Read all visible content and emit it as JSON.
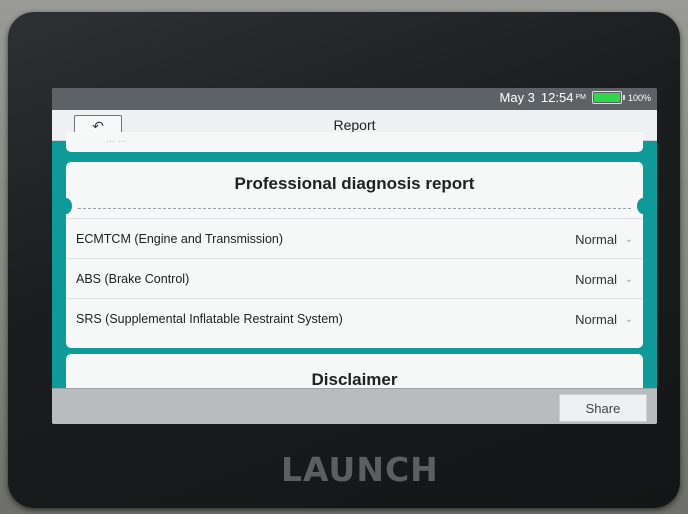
{
  "device": {
    "brand": "LAUNCH"
  },
  "status_bar": {
    "date": "May 3",
    "time": "12:54",
    "ampm": "PM",
    "battery_pct": "100%",
    "battery_level": 1.0
  },
  "title_bar": {
    "title": "Report",
    "back_icon": "back-arrow-icon"
  },
  "top_card": {
    "faded_text": "… …"
  },
  "report": {
    "heading": "Professional diagnosis report",
    "rows": [
      {
        "system": "ECMTCM (Engine and Transmission)",
        "status": "Normal"
      },
      {
        "system": "ABS (Brake Control)",
        "status": "Normal"
      },
      {
        "system": "SRS (Supplemental Inflatable Restraint System)",
        "status": "Normal"
      }
    ]
  },
  "disclaimer": {
    "heading": "Disclaimer"
  },
  "bottom_bar": {
    "share_label": "Share"
  },
  "colors": {
    "accent": "#0f9a9a",
    "battery": "#2ed84a"
  }
}
